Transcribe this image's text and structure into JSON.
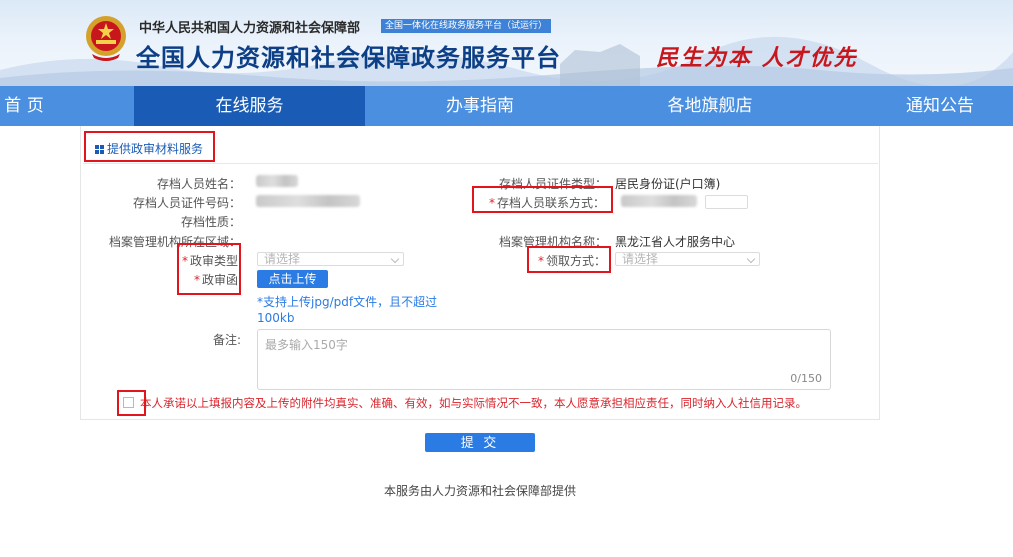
{
  "header": {
    "org_name": "中华人民共和国人力资源和社会保障部",
    "badge": "全国一体化在线政务服务平台（试运行）",
    "site_title": "全国人力资源和社会保障政务服务平台",
    "slogan": "民生为本  人才优先"
  },
  "nav": {
    "items": [
      {
        "label": "首 页",
        "active": false
      },
      {
        "label": "在线服务",
        "active": true
      },
      {
        "label": "办事指南",
        "active": false
      },
      {
        "label": "各地旗舰店",
        "active": false
      },
      {
        "label": "通知公告",
        "active": false
      }
    ]
  },
  "section": {
    "title": "提供政审材料服务"
  },
  "form": {
    "name_label": "存档人员姓名：",
    "id_type_label": "存档人员证件类型：",
    "id_type_value": "居民身份证(户口簿)",
    "id_no_label": "存档人员证件号码：",
    "contact_label": "存档人员联系方式：",
    "nature_label": "存档性质：",
    "region_label": "档案管理机构所在区域：",
    "org_label": "档案管理机构名称：",
    "org_value": "黑龙江省人才服务中心",
    "review_type_label": "政审类型",
    "review_type_placeholder": "请选择",
    "pickup_label": "领取方式：",
    "pickup_placeholder": "请选择",
    "letter_label": "政审函",
    "upload_button": "点击上传",
    "upload_hint": "*支持上传jpg/pdf文件，且不超过100kb",
    "remark_label": "备注:",
    "remark_placeholder": "最多输入150字",
    "remark_count": "0/150",
    "required_mark": "*",
    "agreement": "本人承诺以上填报内容及上传的附件均真实、准确、有效，如与实际情况不一致，本人愿意承担相应责任，同时纳入人社信用记录。",
    "submit": "提 交"
  },
  "footer": {
    "note": "本服务由人力资源和社会保障部提供"
  },
  "colors": {
    "nav_bg": "#4a8fe0",
    "nav_active": "#1a5cb5",
    "primary_button": "#2b7be4",
    "highlight_box": "#e0151e",
    "required": "#d9252c"
  }
}
